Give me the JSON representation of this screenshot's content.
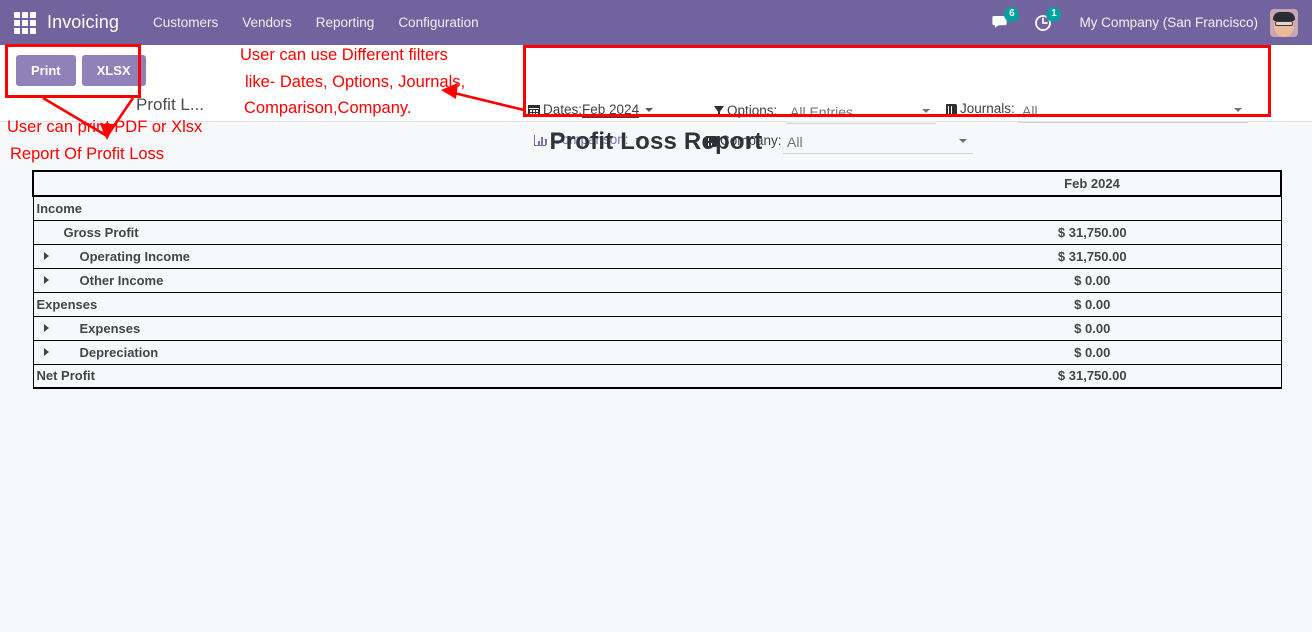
{
  "navbar": {
    "apps_icon": "apps-grid-icon",
    "brand": "Invoicing",
    "menu": [
      {
        "label": "Customers"
      },
      {
        "label": "Vendors"
      },
      {
        "label": "Reporting"
      },
      {
        "label": "Configuration"
      }
    ],
    "messages_icon": "chat-bubble-icon",
    "messages_count": "6",
    "activities_icon": "clock-icon",
    "activities_count": "1",
    "company": "My Company (San Francisco)",
    "avatar_icon": "user-avatar-icon",
    "background_color": "#71639e"
  },
  "control_panel": {
    "print_label": "Print",
    "xlsx_label": "XLSX",
    "breadcrumb": "Profit L...",
    "button_color": "#8f82b8"
  },
  "filters": {
    "dates": {
      "icon": "calendar-icon",
      "label": "Dates:",
      "value": "Feb 2024"
    },
    "comparison": {
      "icon": "bar-chart-icon",
      "label": "Comparison:",
      "value": ""
    },
    "options": {
      "icon": "funnel-icon",
      "label": "Options:",
      "value": "All Entries"
    },
    "company": {
      "icon": "book-icon",
      "label": "Company:",
      "value": "All"
    },
    "journals": {
      "icon": "book-icon",
      "label": "Journals:",
      "value": "All"
    }
  },
  "report": {
    "title": "Profit Loss Report",
    "columns": [
      "",
      "Feb 2024"
    ],
    "rows": [
      {
        "label": "Income",
        "value": "",
        "level": 0,
        "expandable": false
      },
      {
        "label": "Gross Profit",
        "value": "$ 31,750.00",
        "level": 1,
        "expandable": false
      },
      {
        "label": "Operating Income",
        "value": "$ 31,750.00",
        "level": 2,
        "expandable": true
      },
      {
        "label": "Other Income",
        "value": "$ 0.00",
        "level": 2,
        "expandable": true
      },
      {
        "label": "Expenses",
        "value": "$ 0.00",
        "level": 0,
        "expandable": false
      },
      {
        "label": "Expenses",
        "value": "$ 0.00",
        "level": 2,
        "expandable": true
      },
      {
        "label": "Depreciation",
        "value": "$ 0.00",
        "level": 2,
        "expandable": true
      },
      {
        "label": "Net Profit",
        "value": "$ 31,750.00",
        "level": 0,
        "expandable": false
      }
    ]
  },
  "annotations": {
    "color": "#fe0000",
    "print_note_line1": "User can print PDF or Xlsx",
    "print_note_line2": "Report Of Profit Loss",
    "filter_note_line1": "User can use Different filters",
    "filter_note_line2": "like- Dates, Options, Journals,",
    "filter_note_line3": "Comparison,Company."
  }
}
